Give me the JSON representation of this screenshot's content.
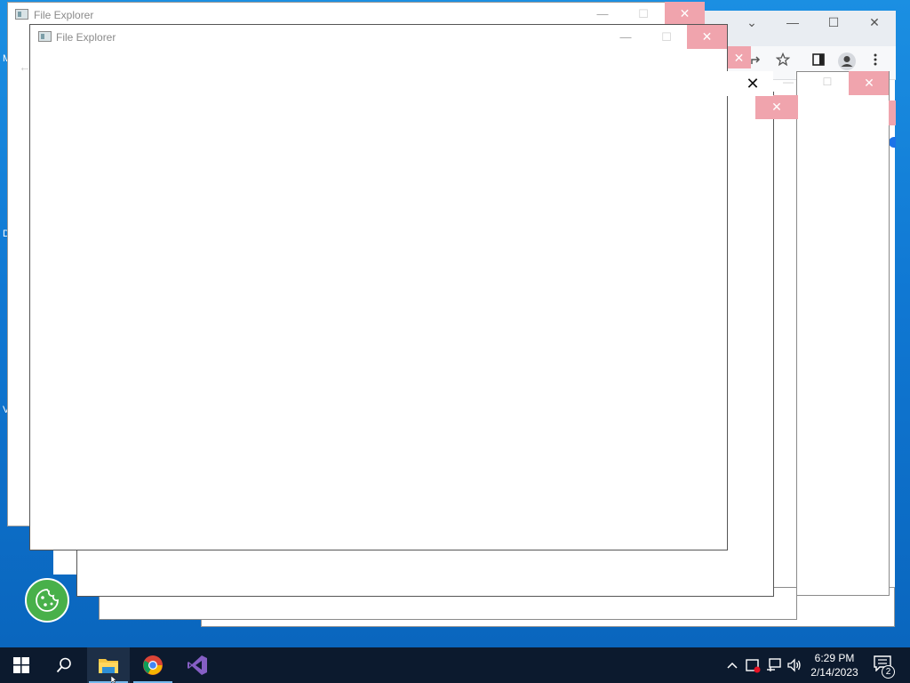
{
  "desktop": {
    "edge_glyphs": [
      "M",
      "D",
      "V"
    ]
  },
  "windows": {
    "back_explorer": {
      "title": "File Explorer",
      "minimize": "—",
      "maximize": "☐",
      "close": "✕"
    },
    "front_explorer": {
      "title": "File Explorer",
      "minimize": "—",
      "maximize": "☐",
      "close": "✕"
    },
    "ghost_close": "✕"
  },
  "chrome": {
    "tab_menu": "⌄",
    "minimize": "—",
    "maximize": "☐",
    "close": "✕"
  },
  "dialog": {
    "close": "✕"
  },
  "taskbar": {
    "apps": [
      "start",
      "search",
      "file-explorer",
      "chrome",
      "visual-studio"
    ],
    "clock_time": "6:29 PM",
    "clock_date": "2/14/2023",
    "notification_count": "2"
  },
  "colors": {
    "desktop_blue": "#1078d3",
    "taskbar": "#0c1a2e",
    "ghost_close_pink": "#f0a4ad",
    "cookie_green": "#48b04a"
  }
}
